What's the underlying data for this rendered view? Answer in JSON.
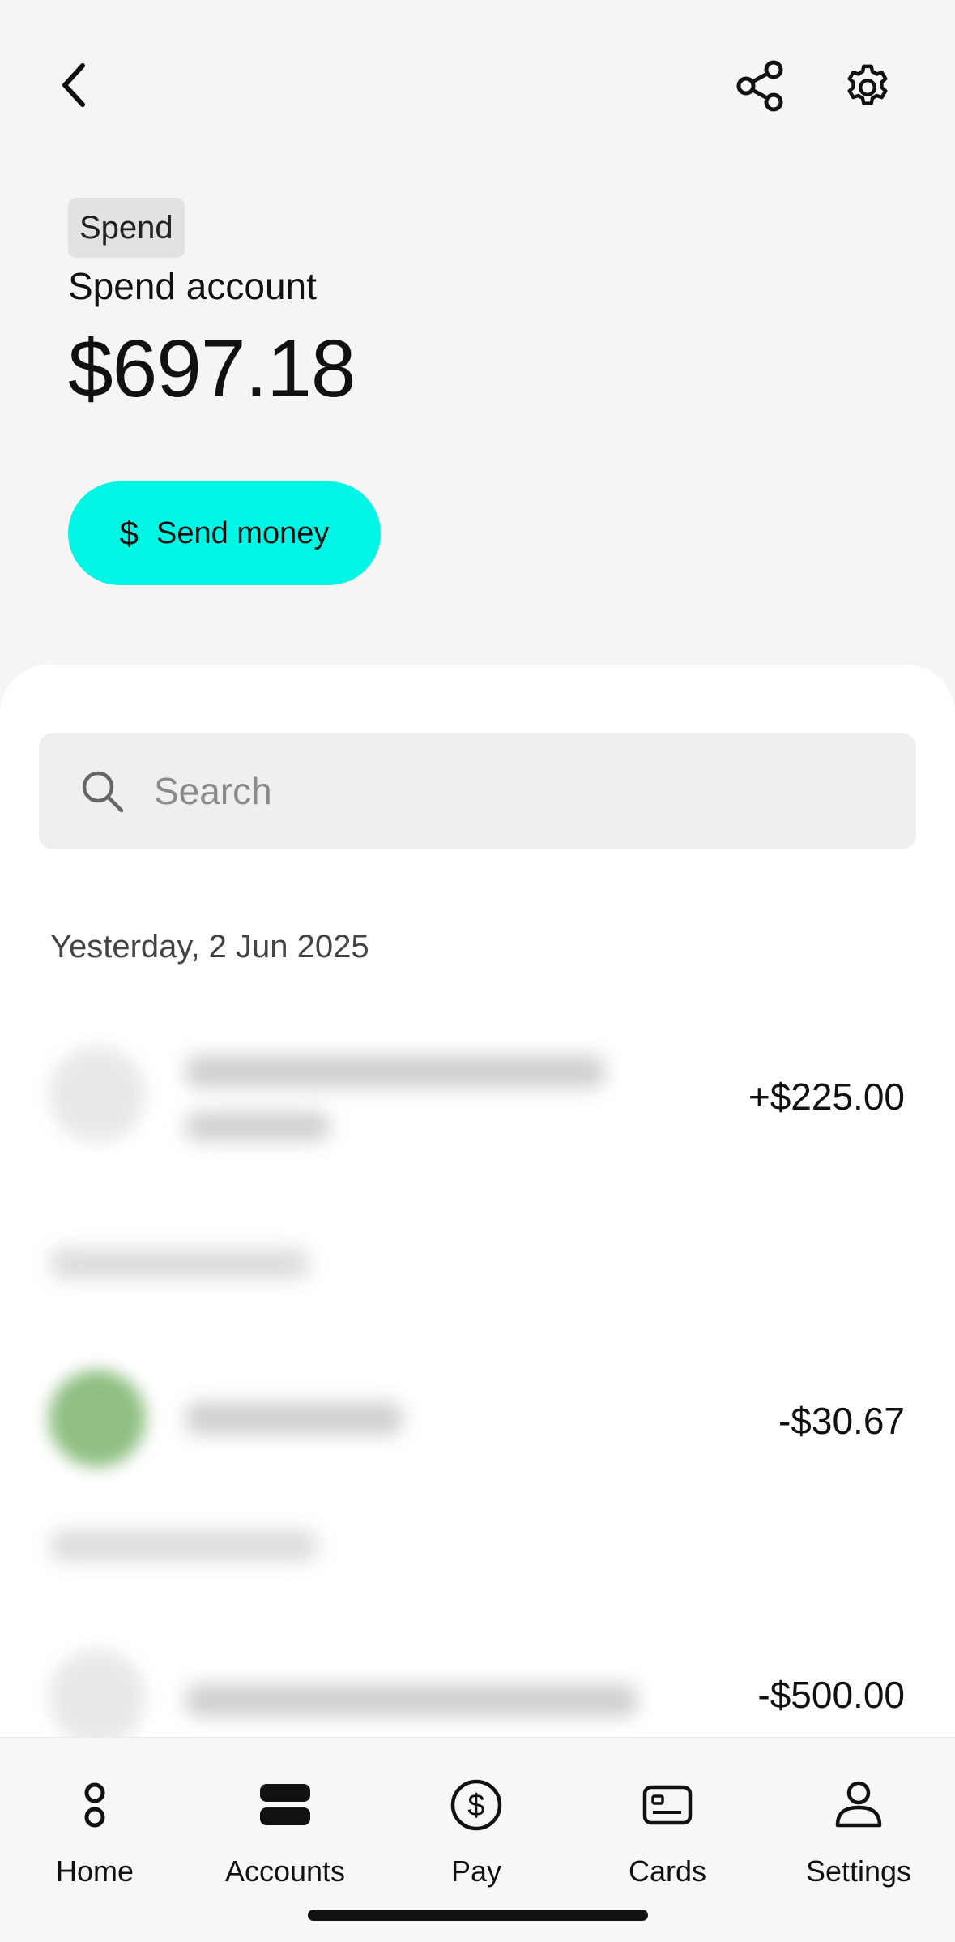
{
  "account": {
    "tag": "Spend",
    "name": "Spend account",
    "balance": "$697.18",
    "send_label": "Send money"
  },
  "search": {
    "placeholder": "Search"
  },
  "transactions": {
    "date_header": "Yesterday, 2 Jun 2025",
    "items": [
      {
        "amount": "+$225.00"
      },
      {
        "amount": "-$30.67",
        "avatar_color": "#8fbf82"
      },
      {
        "amount": "-$500.00"
      }
    ]
  },
  "nav": {
    "items": [
      {
        "label": "Home",
        "icon": "home-dots-icon"
      },
      {
        "label": "Accounts",
        "icon": "accounts-icon"
      },
      {
        "label": "Pay",
        "icon": "dollar-circle-icon"
      },
      {
        "label": "Cards",
        "icon": "card-icon"
      },
      {
        "label": "Settings",
        "icon": "person-icon"
      }
    ]
  },
  "colors": {
    "accent": "#00f5e4"
  }
}
